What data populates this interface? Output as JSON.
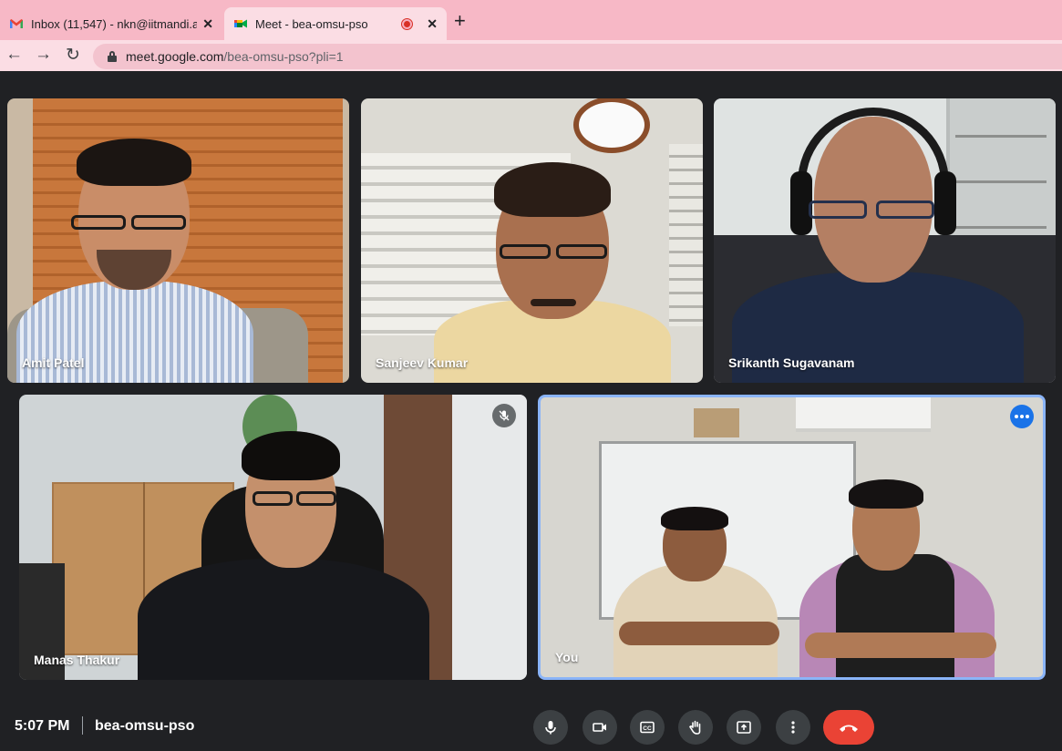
{
  "browser": {
    "tabs": [
      {
        "title": "Inbox (11,547) - nkn@iitmandi.ac",
        "favicon": "gmail-icon",
        "active": false
      },
      {
        "title": "Meet - bea-omsu-pso",
        "favicon": "meet-icon",
        "active": true,
        "recording": true
      }
    ],
    "url_host": "meet.google.com",
    "url_path": "/bea-omsu-pso?pli=1"
  },
  "participants": [
    {
      "name": "Amit Patel"
    },
    {
      "name": "Sanjeev Kumar"
    },
    {
      "name": "Srikanth Sugavanam"
    },
    {
      "name": "Manas Thakur",
      "muted": true
    },
    {
      "name": "You",
      "self": true
    }
  ],
  "meeting": {
    "time": "5:07 PM",
    "code": "bea-omsu-pso"
  },
  "controls": [
    {
      "name": "microphone-button",
      "icon": "mic-icon"
    },
    {
      "name": "camera-button",
      "icon": "camera-icon"
    },
    {
      "name": "captions-button",
      "icon": "cc-icon"
    },
    {
      "name": "raise-hand-button",
      "icon": "hand-icon"
    },
    {
      "name": "present-button",
      "icon": "present-icon"
    },
    {
      "name": "more-options-button",
      "icon": "more-vertical-icon"
    },
    {
      "name": "leave-call-button",
      "icon": "end-call-icon"
    }
  ],
  "colors": {
    "tabbar": "#f7b8c6",
    "meet_bg": "#202124",
    "control_bg": "#3c4043",
    "end_call": "#ea4335",
    "active_speaker_border": "#8ab4f8"
  }
}
